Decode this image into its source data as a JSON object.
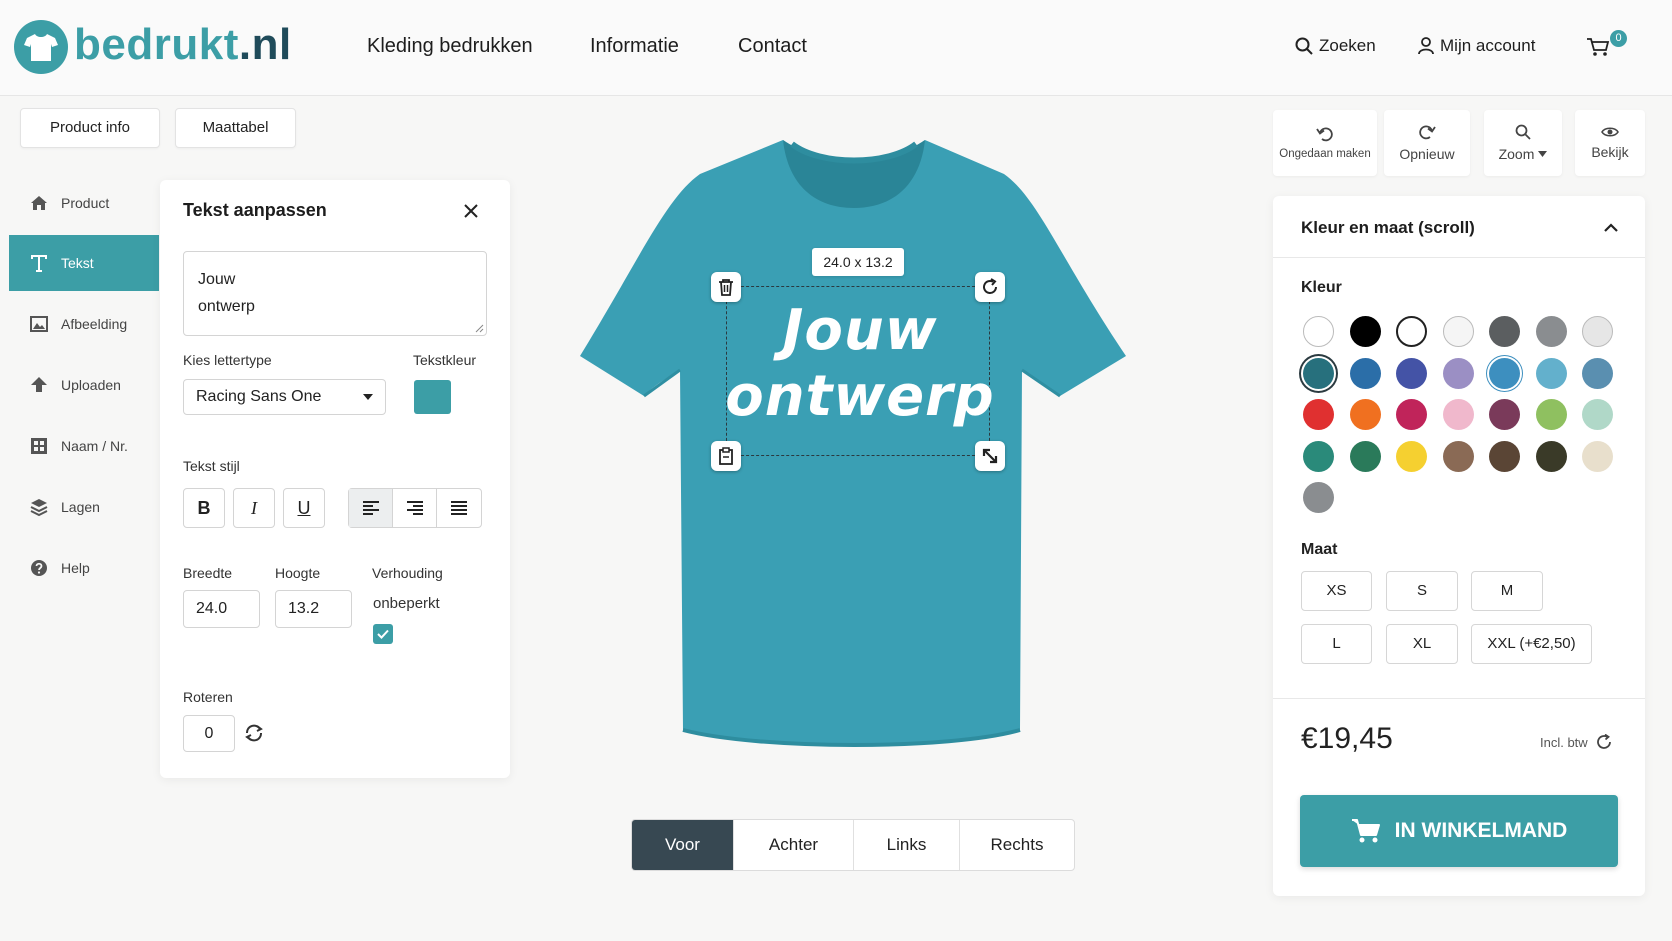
{
  "header": {
    "logo_main": "bedrukt",
    "logo_tld": ".nl",
    "nav": [
      "Kleding bedrukken",
      "Informatie",
      "Contact"
    ],
    "search_label": "Zoeken",
    "account_label": "Mijn account",
    "cart_count": "0"
  },
  "top_buttons": {
    "product_info": "Product info",
    "size_chart": "Maattabel"
  },
  "sidebar": {
    "items": [
      {
        "label": "Product",
        "icon": "home-icon"
      },
      {
        "label": "Tekst",
        "icon": "text-icon"
      },
      {
        "label": "Afbeelding",
        "icon": "image-icon"
      },
      {
        "label": "Uploaden",
        "icon": "upload-icon"
      },
      {
        "label": "Naam / Nr.",
        "icon": "grid-icon"
      },
      {
        "label": "Lagen",
        "icon": "layers-icon"
      },
      {
        "label": "Help",
        "icon": "help-icon"
      }
    ],
    "active_index": 1
  },
  "text_panel": {
    "title": "Tekst aanpassen",
    "text_line1": "Jouw",
    "text_line2": "ontwerp",
    "font_label": "Kies lettertype",
    "font_value": "Racing Sans One",
    "color_label": "Tekstkleur",
    "text_color": "#3c9ea6",
    "style_label": "Tekst stijl",
    "bold": "B",
    "italic": "I",
    "underline": "U",
    "width_label": "Breedte",
    "width_value": "24.0",
    "height_label": "Hoogte",
    "height_value": "13.2",
    "ratio_label": "Verhouding",
    "ratio_value": "onbeperkt",
    "ratio_checked": true,
    "rotate_label": "Roteren",
    "rotate_value": "0"
  },
  "canvas": {
    "dimensions": "24.0 x 13.2",
    "design_line1": "Jouw",
    "design_line2": "ontwerp",
    "shirt_color": "#3a9fb4"
  },
  "view_tabs": {
    "items": [
      "Voor",
      "Achter",
      "Links",
      "Rechts"
    ],
    "active_index": 0
  },
  "toolbar": {
    "undo": "Ongedaan maken",
    "redo": "Opnieuw",
    "zoom": "Zoom",
    "preview": "Bekijk"
  },
  "color_size": {
    "title": "Kleur en maat (scroll)",
    "color_label": "Kleur",
    "colors": [
      "#ffffff",
      "#000000",
      "#ffffff",
      "#f5f5f5",
      "#5b5e60",
      "#8a8d90",
      "#e6e6e6",
      "#27707d",
      "#2b6ea8",
      "#4453a6",
      "#9b8fc4",
      "#3d8fbf",
      "#63b0cc",
      "#5a8fb0",
      "#e03030",
      "#f07020",
      "#c0245a",
      "#f0b8cc",
      "#7a3a5a",
      "#8fc060",
      "#b0d8c8",
      "#2a8a7a",
      "#2a7a5a",
      "#f5d030",
      "#8a6a55",
      "#5a4535",
      "#3a3a28",
      "#e8dfcc",
      "#8a8d90"
    ],
    "selected_color": 7,
    "size_label": "Maat",
    "sizes": [
      "XS",
      "S",
      "M",
      "L",
      "XL",
      "XXL (+€2,50)"
    ],
    "price": "€19,45",
    "price_note": "Incl. btw",
    "cta": "IN WINKELMAND"
  }
}
